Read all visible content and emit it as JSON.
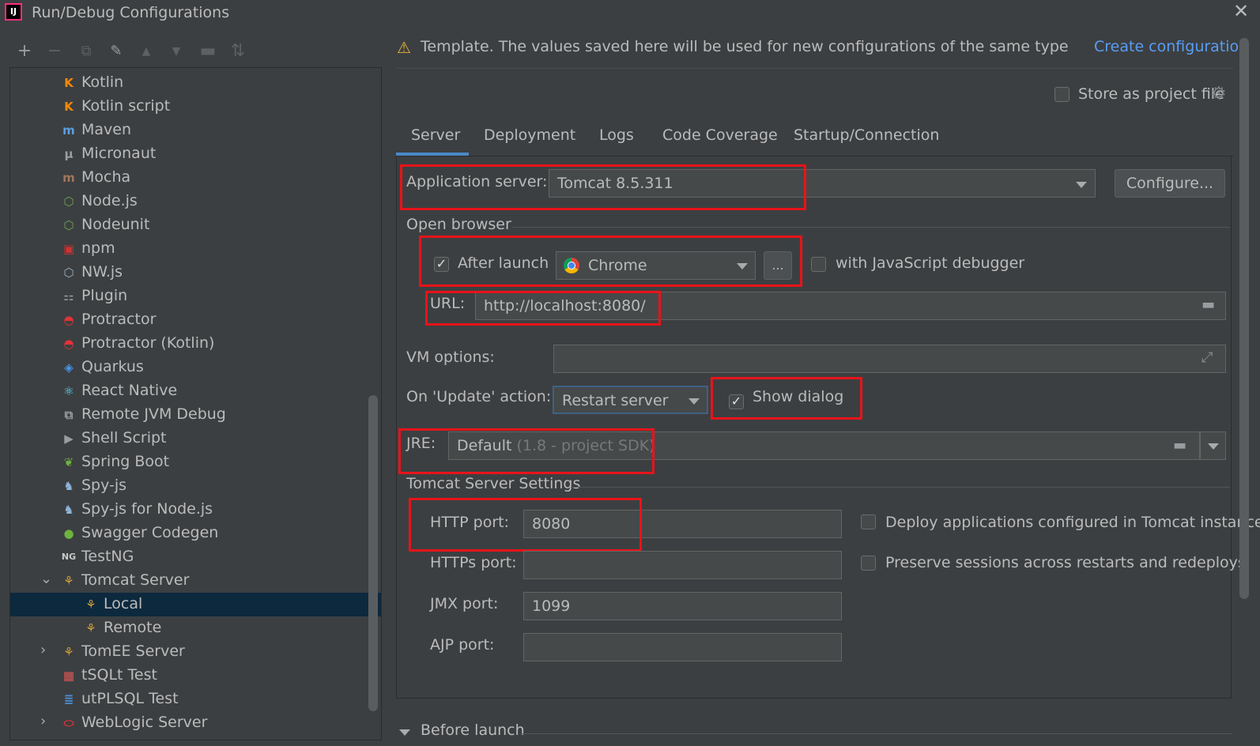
{
  "window": {
    "title": "Run/Debug Configurations",
    "app_icon_text": "IJ"
  },
  "toolbar": {
    "icons": [
      "add-icon",
      "remove-icon",
      "copy-icon",
      "wrench-icon",
      "move-up-icon",
      "move-down-icon",
      "folder-icon",
      "sort-icon"
    ],
    "glyphs": {
      "add": "+",
      "remove": "−",
      "copy": "⧉",
      "wrench": "🔧",
      "up": "▲",
      "down": "▼",
      "folder": "▬",
      "sort": "⇅"
    }
  },
  "tree": {
    "items": [
      {
        "label": "Kotlin",
        "icon": "kotlin-icon",
        "glyph": "K",
        "color": "#f88909"
      },
      {
        "label": "Kotlin script",
        "icon": "kotlin-script-icon",
        "glyph": "K",
        "color": "#f88909"
      },
      {
        "label": "Maven",
        "icon": "maven-icon",
        "glyph": "m",
        "color": "#5d9de0"
      },
      {
        "label": "Micronaut",
        "icon": "micronaut-icon",
        "glyph": "μ",
        "color": "#9a9da0"
      },
      {
        "label": "Mocha",
        "icon": "mocha-icon",
        "glyph": "m",
        "color": "#a0765c"
      },
      {
        "label": "Node.js",
        "icon": "nodejs-icon",
        "glyph": "⬡",
        "color": "#6aa84f"
      },
      {
        "label": "Nodeunit",
        "icon": "nodeunit-icon",
        "glyph": "⬡",
        "color": "#6aa84f"
      },
      {
        "label": "npm",
        "icon": "npm-icon",
        "glyph": "▣",
        "color": "#cc3333"
      },
      {
        "label": "NW.js",
        "icon": "nwjs-icon",
        "glyph": "⬡",
        "color": "#9ab0c8"
      },
      {
        "label": "Plugin",
        "icon": "plugin-icon",
        "glyph": "⚏",
        "color": "#9a9da0"
      },
      {
        "label": "Protractor",
        "icon": "protractor-icon",
        "glyph": "◓",
        "color": "#e23237"
      },
      {
        "label": "Protractor (Kotlin)",
        "icon": "protractor-kotlin-icon",
        "glyph": "◓",
        "color": "#e23237"
      },
      {
        "label": "Quarkus",
        "icon": "quarkus-icon",
        "glyph": "◈",
        "color": "#4695eb"
      },
      {
        "label": "React Native",
        "icon": "react-icon",
        "glyph": "⚛",
        "color": "#61dafb"
      },
      {
        "label": "Remote JVM Debug",
        "icon": "remote-debug-icon",
        "glyph": "⧉",
        "color": "#9a9da0"
      },
      {
        "label": "Shell Script",
        "icon": "shell-icon",
        "glyph": "▶",
        "color": "#9a9da0"
      },
      {
        "label": "Spring Boot",
        "icon": "spring-boot-icon",
        "glyph": "❦",
        "color": "#6db33f"
      },
      {
        "label": "Spy-js",
        "icon": "spyjs-icon",
        "glyph": "♞",
        "color": "#8fb6d9"
      },
      {
        "label": "Spy-js for Node.js",
        "icon": "spyjs-node-icon",
        "glyph": "♞",
        "color": "#8fb6d9"
      },
      {
        "label": "Swagger Codegen",
        "icon": "swagger-icon",
        "glyph": "●",
        "color": "#6db33f"
      },
      {
        "label": "TestNG",
        "icon": "testng-icon",
        "glyph": "NG",
        "color": "#c9c9c9"
      },
      {
        "label": "Tomcat Server",
        "icon": "tomcat-icon",
        "glyph": "⚘",
        "color": "#d1a33a",
        "expanded": true
      },
      {
        "label": "Local",
        "icon": "tomcat-icon",
        "glyph": "⚘",
        "color": "#d1a33a",
        "selected": true,
        "child": true
      },
      {
        "label": "Remote",
        "icon": "tomcat-icon",
        "glyph": "⚘",
        "color": "#d1a33a",
        "child": true
      },
      {
        "label": "TomEE Server",
        "icon": "tomee-icon",
        "glyph": "⚘",
        "color": "#d1a33a",
        "collapsed": true
      },
      {
        "label": "tSQLt Test",
        "icon": "tsqlt-icon",
        "glyph": "▦",
        "color": "#e05555"
      },
      {
        "label": "utPLSQL Test",
        "icon": "utplsql-icon",
        "glyph": "≣",
        "color": "#4a90d9"
      },
      {
        "label": "WebLogic Server",
        "icon": "weblogic-icon",
        "glyph": "⬭",
        "color": "#e23237",
        "collapsed": true
      }
    ]
  },
  "banner": {
    "warning_glyph": "⚠",
    "text": "Template. The values saved here will be used for new configurations of the same type",
    "create_link": "Create configuration"
  },
  "store": {
    "label": "Store as project file",
    "checked": false,
    "gear_glyph": "⚙"
  },
  "tabs": [
    {
      "label": "Server",
      "active": true
    },
    {
      "label": "Deployment"
    },
    {
      "label": "Logs"
    },
    {
      "label": "Code Coverage"
    },
    {
      "label": "Startup/Connection"
    }
  ],
  "server": {
    "app_server_label": "Application server:",
    "app_server_value": "Tomcat 8.5.311",
    "configure_label": "Configure...",
    "open_browser_title": "Open browser",
    "after_launch_label": "After launch",
    "after_launch_checked": true,
    "browser_value": "Chrome",
    "ellipsis_label": "...",
    "js_debugger_label": "with JavaScript debugger",
    "js_debugger_checked": false,
    "url_label": "URL:",
    "url_value": "http://localhost:8080/",
    "vm_options_label": "VM options:",
    "vm_options_value": "",
    "expand_glyph": "⤢",
    "on_update_label": "On 'Update' action:",
    "on_update_value": "Restart server",
    "show_dialog_label": "Show dialog",
    "show_dialog_checked": true,
    "jre_label": "JRE:",
    "jre_value": "Default",
    "jre_hint": "(1.8 - project SDK)",
    "tomcat_settings_title": "Tomcat Server Settings",
    "http_port_label": "HTTP port:",
    "http_port_value": "8080",
    "https_port_label": "HTTPs port:",
    "https_port_value": "",
    "jmx_port_label": "JMX port:",
    "jmx_port_value": "1099",
    "ajp_port_label": "AJP port:",
    "ajp_port_value": "",
    "deploy_label": "Deploy applications configured in Tomcat instance",
    "deploy_checked": false,
    "preserve_label": "Preserve sessions across restarts and redeploys",
    "preserve_checked": false,
    "check_glyph": "✓"
  },
  "before_launch": {
    "label": "Before launch"
  },
  "colors": {
    "background": "#3c3f41",
    "selection": "#0d293e",
    "link": "#589df6",
    "highlight": "#e8131a",
    "tab_underline": "#4a88c7"
  }
}
